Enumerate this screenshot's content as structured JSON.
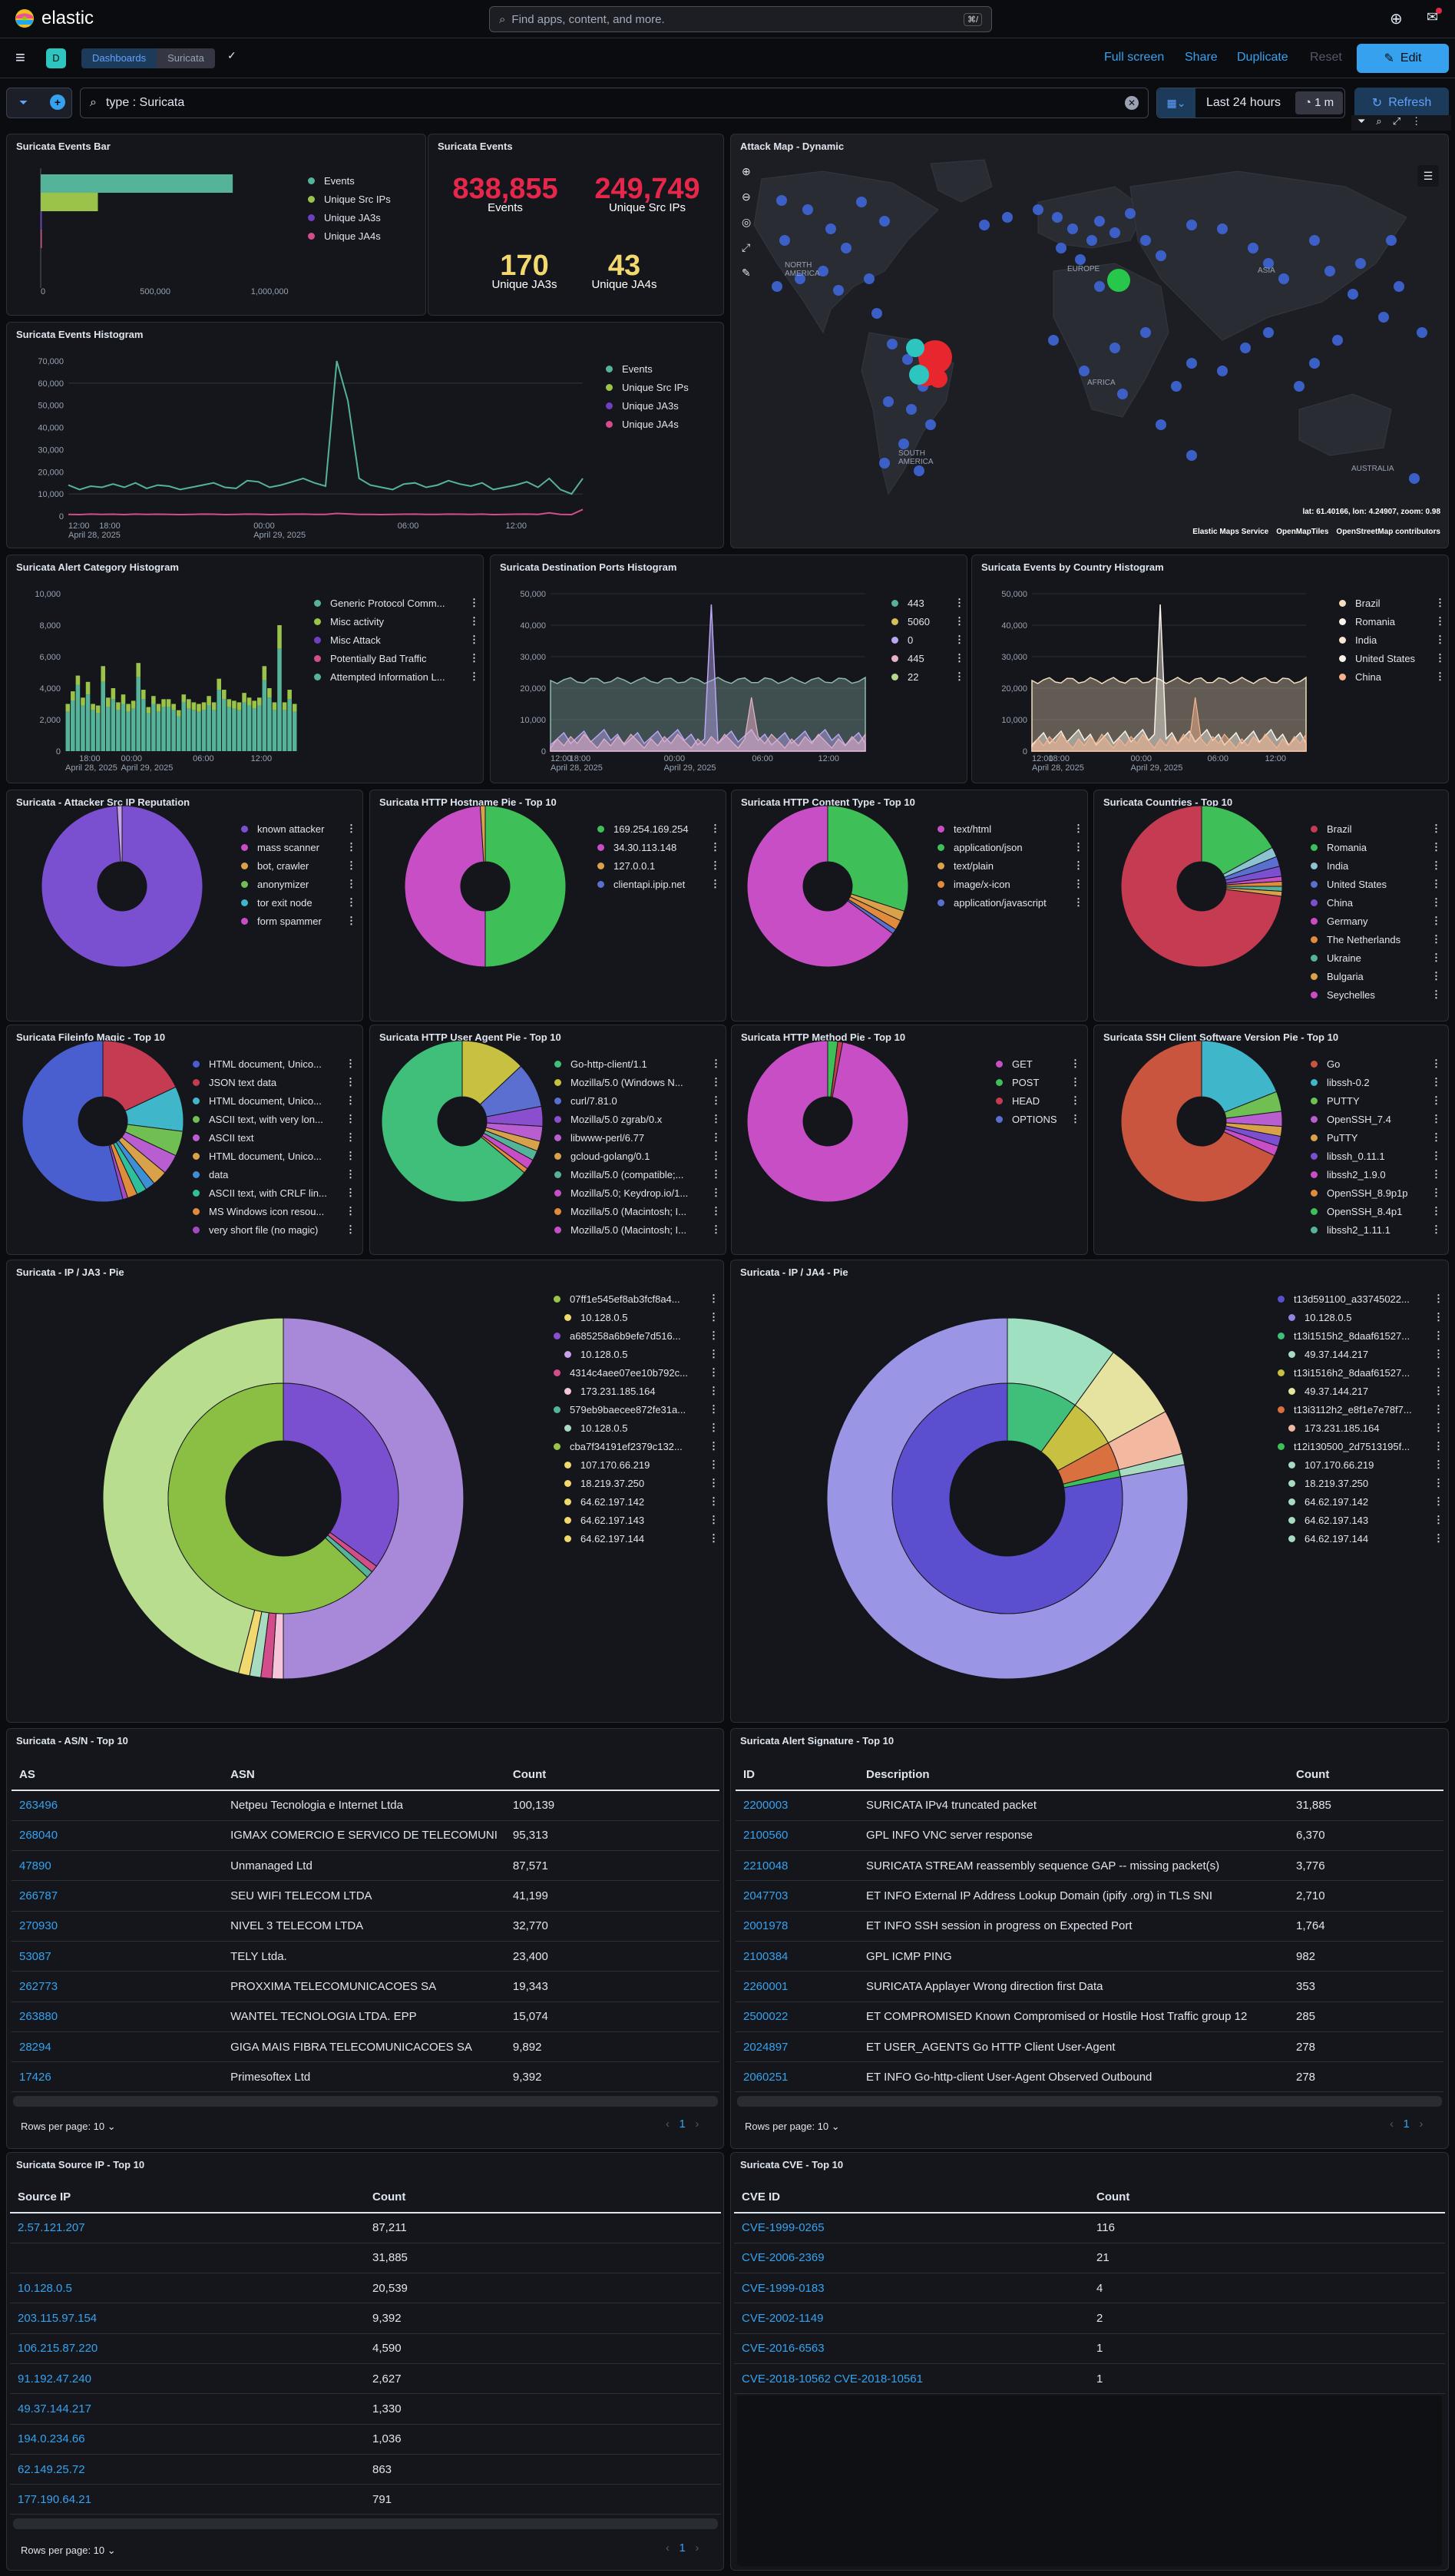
{
  "app": {
    "brand": "elastic",
    "search_placeholder": "Find apps, content, and more.",
    "search_kbd": "⌘/"
  },
  "nav": {
    "space": "D",
    "breadcrumbs": [
      "Dashboards",
      "Suricata"
    ],
    "fullscreen": "Full screen",
    "share": "Share",
    "duplicate": "Duplicate",
    "reset": "Reset",
    "edit": "Edit"
  },
  "query": {
    "text": "type : Suricata",
    "time": "Last 24 hours",
    "refresh_interval": "1 m",
    "refresh": "Refresh"
  },
  "colors": {
    "teal": "#54b399",
    "green": "#9bc34a",
    "purple": "#6f3fc1",
    "pink": "#d34d8a",
    "red": "#e7264b",
    "yellow": "#f1d86f"
  },
  "events_bar": {
    "title": "Suricata Events Bar",
    "legend": [
      "Events",
      "Unique Src IPs",
      "Unique JA3s",
      "Unique JA4s"
    ],
    "ticks": [
      "0",
      "500,000",
      "1,000,000"
    ],
    "chart_data": {
      "type": "bar",
      "categories": [
        "Events",
        "Unique Src IPs",
        "Unique JA3s",
        "Unique JA4s"
      ],
      "values": [
        838855,
        249749,
        170,
        43
      ],
      "xlim": [
        0,
        1100000
      ]
    }
  },
  "events": {
    "title": "Suricata Events",
    "metrics": [
      {
        "value": "838,855",
        "label": "Events"
      },
      {
        "value": "249,749",
        "label": "Unique Src IPs"
      },
      {
        "value": "170",
        "label": "Unique JA3s"
      },
      {
        "value": "43",
        "label": "Unique JA4s"
      }
    ]
  },
  "map": {
    "title": "Attack Map - Dynamic",
    "labels": [
      "NORTH AMERICA",
      "EUROPE",
      "ASIA",
      "AFRICA",
      "SOUTH AMERICA",
      "AUSTRALIA"
    ],
    "coords": "lat: 61.40166, lon: 4.24907, zoom: 0.98",
    "attribution": [
      "Elastic Maps Service",
      "OpenMapTiles",
      "OpenStreetMap contributors"
    ]
  },
  "histogram": {
    "title": "Suricata Events Histogram",
    "legend": [
      "Events",
      "Unique Src IPs",
      "Unique JA3s",
      "Unique JA4s"
    ],
    "yticks": [
      "70,000",
      "60,000",
      "50,000",
      "40,000",
      "30,000",
      "20,000",
      "10,000",
      "0"
    ],
    "xticks": [
      "12:00",
      "18:00",
      "00:00",
      "06:00",
      "12:00"
    ],
    "dates": [
      "April 28, 2025",
      "April 29, 2025"
    ],
    "chart_data": {
      "type": "line",
      "series": [
        {
          "name": "Events",
          "values": [
            14000,
            12000,
            13500,
            13000,
            14500,
            13000,
            15000,
            12500,
            14000,
            13500,
            12000,
            13000,
            14000,
            15000,
            13000,
            12500,
            16000,
            15500,
            13000,
            14000,
            15500,
            17000,
            15000,
            13500,
            70000,
            52000,
            17000,
            14000,
            13000,
            12000,
            14500,
            15000,
            13000,
            14000,
            16000,
            14500,
            13500,
            15000,
            12000,
            13000,
            14000,
            15500,
            13000,
            17000,
            12000,
            10000,
            17000
          ]
        },
        {
          "name": "Unique Src IPs",
          "values": [
            800,
            700,
            900,
            750,
            850,
            700,
            900,
            800,
            850,
            750,
            700,
            800,
            900,
            850,
            700,
            800,
            900,
            850,
            700,
            800,
            850,
            900,
            800,
            750,
            1200,
            1000,
            800,
            750,
            700,
            800,
            850,
            900,
            800,
            750,
            900,
            850,
            800,
            900,
            700,
            800,
            850,
            900,
            800,
            1500,
            800,
            700,
            3000
          ]
        }
      ],
      "ylim": [
        0,
        70000
      ]
    }
  },
  "alert_cat": {
    "title": "Suricata Alert Category Histogram",
    "legend": [
      "Generic Protocol Comm...",
      "Misc activity",
      "Misc Attack",
      "Potentially Bad Traffic",
      "Attempted Information L..."
    ],
    "yticks": [
      "10,000",
      "8,000",
      "6,000",
      "4,000",
      "2,000",
      "0"
    ],
    "xticks": [
      "18:00",
      "00:00",
      "06:00",
      "12:00"
    ],
    "dates": [
      "April 28, 2025",
      "April 29, 2025"
    ],
    "chart_data": {
      "type": "bar",
      "stacked": true,
      "series": [
        {
          "name": "Generic Protocol Comm...",
          "values": [
            2500,
            3200,
            4200,
            2900,
            3600,
            2600,
            2400,
            4400,
            2800,
            3300,
            2600,
            3000,
            2500,
            2700,
            4700,
            3300,
            2400,
            3000,
            2500,
            2800,
            2800,
            2600,
            2200,
            3100,
            2700,
            2600,
            2500,
            2600,
            2900,
            2600,
            3900,
            3300,
            2800,
            2700,
            2600,
            3100,
            2900,
            2700,
            2900,
            4500,
            3400,
            2600,
            6500,
            2600,
            3300,
            2500
          ]
        },
        {
          "name": "Misc activity",
          "values": [
            500,
            600,
            600,
            500,
            800,
            400,
            500,
            1000,
            600,
            700,
            500,
            600,
            500,
            500,
            900,
            600,
            400,
            500,
            500,
            500,
            500,
            400,
            400,
            500,
            600,
            500,
            500,
            500,
            600,
            500,
            700,
            600,
            500,
            500,
            500,
            600,
            500,
            500,
            500,
            900,
            600,
            500,
            1500,
            500,
            600,
            500
          ]
        }
      ],
      "ylim": [
        0,
        10000
      ]
    }
  },
  "dest_ports": {
    "title": "Suricata Destination Ports Histogram",
    "legend": [
      "443",
      "5060",
      "0",
      "445",
      "22"
    ],
    "yticks": [
      "50,000",
      "40,000",
      "30,000",
      "20,000",
      "10,000",
      "0"
    ],
    "xticks": [
      "12:00",
      "18:00",
      "00:00",
      "06:00",
      "12:00"
    ],
    "dates": [
      "April 28, 2025",
      "April 29, 2025"
    ]
  },
  "country_hist": {
    "title": "Suricata Events by Country Histogram",
    "legend": [
      "Brazil",
      "Romania",
      "India",
      "United States",
      "China"
    ],
    "yticks": [
      "50,000",
      "40,000",
      "30,000",
      "20,000",
      "10,000",
      "0"
    ],
    "xticks": [
      "12:00",
      "18:00",
      "00:00",
      "06:00",
      "12:00"
    ],
    "dates": [
      "April 28, 2025",
      "April 29, 2025"
    ]
  },
  "pie_rep": {
    "title": "Suricata - Attacker Src IP Reputation",
    "legend": [
      "known attacker",
      "mass scanner",
      "bot, crawler",
      "anonymizer",
      "tor exit node",
      "form spammer"
    ]
  },
  "pie_host": {
    "title": "Suricata HTTP Hostname Pie - Top 10",
    "legend": [
      "169.254.169.254",
      "34.30.113.148",
      "127.0.0.1",
      "clientapi.ipip.net"
    ]
  },
  "pie_ctype": {
    "title": "Suricata HTTP Content Type - Top 10",
    "legend": [
      "text/html",
      "application/json",
      "text/plain",
      "image/x-icon",
      "application/javascript"
    ]
  },
  "pie_country": {
    "title": "Suricata Countries - Top 10",
    "legend": [
      "Brazil",
      "Romania",
      "India",
      "United States",
      "China",
      "Germany",
      "The Netherlands",
      "Ukraine",
      "Bulgaria",
      "Seychelles"
    ]
  },
  "pie_magic": {
    "title": "Suricata Fileinfo Magic - Top 10",
    "legend": [
      "HTML document, Unico...",
      "JSON text data",
      "HTML document, Unico...",
      "ASCII text, with very lon...",
      "ASCII text",
      "HTML document, Unico...",
      "data",
      "ASCII text, with CRLF lin...",
      "MS Windows icon resou...",
      "very short file (no magic)"
    ]
  },
  "pie_ua": {
    "title": "Suricata HTTP User Agent Pie - Top 10",
    "legend": [
      "Go-http-client/1.1",
      "Mozilla/5.0 (Windows N...",
      "curl/7.81.0",
      "Mozilla/5.0 zgrab/0.x",
      "libwww-perl/6.77",
      "gcloud-golang/0.1",
      "Mozilla/5.0 (compatible;...",
      "Mozilla/5.0; Keydrop.io/1...",
      "Mozilla/5.0 (Macintosh; I...",
      "Mozilla/5.0 (Macintosh; I..."
    ]
  },
  "pie_method": {
    "title": "Suricata HTTP Method Pie - Top 10",
    "legend": [
      "GET",
      "POST",
      "HEAD",
      "OPTIONS"
    ]
  },
  "pie_ssh": {
    "title": "Suricata SSH Client Software Version Pie - Top 10",
    "legend": [
      "Go",
      "libssh-0.2",
      "PUTTY",
      "OpenSSH_7.4",
      "PuTTY",
      "libssh_0.11.1",
      "libssh2_1.9.0",
      "OpenSSH_8.9p1p",
      "OpenSSH_8.4p1",
      "libssh2_1.11.1"
    ]
  },
  "ja3": {
    "title": "Suricata - IP / JA3 - Pie",
    "legend": [
      "07ff1e545ef8ab3fcf8a4...",
      "10.128.0.5",
      "a685258a6b9efe7d516...",
      "10.128.0.5",
      "4314c4aee07ee10b792c...",
      "173.231.185.164",
      "579eb9baecee872fe31a...",
      "10.128.0.5",
      "cba7f34191ef2379c132...",
      "107.170.66.219",
      "18.219.37.250",
      "64.62.197.142",
      "64.62.197.143",
      "64.62.197.144"
    ]
  },
  "ja4": {
    "title": "Suricata - IP / JA4 - Pie",
    "legend": [
      "t13d591100_a33745022...",
      "10.128.0.5",
      "t13i1515h2_8daaf61527...",
      "49.37.144.217",
      "t13i1516h2_8daaf61527...",
      "49.37.144.217",
      "t13i3112h2_e8f1e7e78f7...",
      "173.231.185.164",
      "t12i130500_2d7513195f...",
      "107.170.66.219",
      "18.219.37.250",
      "64.62.197.142",
      "64.62.197.143",
      "64.62.197.144"
    ]
  },
  "asn": {
    "title": "Suricata - AS/N - Top 10",
    "cols": [
      "AS",
      "ASN",
      "Count"
    ],
    "rows": [
      [
        "263496",
        "Netpeu Tecnologia e Internet Ltda",
        "100,139"
      ],
      [
        "268040",
        "IGMAX COMERCIO E SERVICO DE TELECOMUNI",
        "95,313"
      ],
      [
        "47890",
        "Unmanaged Ltd",
        "87,571"
      ],
      [
        "266787",
        "SEU WIFI TELECOM LTDA",
        "41,199"
      ],
      [
        "270930",
        "NIVEL 3 TELECOM LTDA",
        "32,770"
      ],
      [
        "53087",
        "TELY Ltda.",
        "23,400"
      ],
      [
        "262773",
        "PROXXIMA TELECOMUNICACOES SA",
        "19,343"
      ],
      [
        "263880",
        "WANTEL TECNOLOGIA LTDA. EPP",
        "15,074"
      ],
      [
        "28294",
        "GIGA MAIS FIBRA TELECOMUNICACOES SA",
        "9,892"
      ],
      [
        "17426",
        "Primesoftex Ltd",
        "9,392"
      ]
    ],
    "rows_per_page": "Rows per page: 10",
    "page": "1"
  },
  "sig": {
    "title": "Suricata Alert Signature - Top 10",
    "cols": [
      "ID",
      "Description",
      "Count"
    ],
    "rows": [
      [
        "2200003",
        "SURICATA IPv4 truncated packet",
        "31,885"
      ],
      [
        "2100560",
        "GPL INFO VNC server response",
        "6,370"
      ],
      [
        "2210048",
        "SURICATA STREAM reassembly sequence GAP -- missing packet(s)",
        "3,776"
      ],
      [
        "2047703",
        "ET INFO External IP Address Lookup Domain (ipify .org) in TLS SNI",
        "2,710"
      ],
      [
        "2001978",
        "ET INFO SSH session in progress on Expected Port",
        "1,764"
      ],
      [
        "2100384",
        "GPL ICMP PING",
        "982"
      ],
      [
        "2260001",
        "SURICATA Applayer Wrong direction first Data",
        "353"
      ],
      [
        "2500022",
        "ET COMPROMISED Known Compromised or Hostile Host Traffic group 12",
        "285"
      ],
      [
        "2024897",
        "ET USER_AGENTS Go HTTP Client User-Agent",
        "278"
      ],
      [
        "2060251",
        "ET INFO Go-http-client User-Agent Observed Outbound",
        "278"
      ]
    ],
    "rows_per_page": "Rows per page: 10",
    "page": "1"
  },
  "srcip": {
    "title": "Suricata Source IP - Top 10",
    "cols": [
      "Source IP",
      "Count"
    ],
    "rows": [
      [
        "2.57.121.207",
        "87,211"
      ],
      [
        "",
        "31,885"
      ],
      [
        "10.128.0.5",
        "20,539"
      ],
      [
        "203.115.97.154",
        "9,392"
      ],
      [
        "106.215.87.220",
        "4,590"
      ],
      [
        "91.192.47.240",
        "2,627"
      ],
      [
        "49.37.144.217",
        "1,330"
      ],
      [
        "194.0.234.66",
        "1,036"
      ],
      [
        "62.149.25.72",
        "863"
      ],
      [
        "177.190.64.21",
        "791"
      ]
    ],
    "rows_per_page": "Rows per page: 10",
    "page": "1"
  },
  "cve": {
    "title": "Suricata CVE - Top 10",
    "cols": [
      "CVE ID",
      "Count"
    ],
    "rows": [
      [
        "CVE-1999-0265",
        "116"
      ],
      [
        "CVE-2006-2369",
        "21"
      ],
      [
        "CVE-1999-0183",
        "4"
      ],
      [
        "CVE-2002-1149",
        "2"
      ],
      [
        "CVE-2016-6563",
        "1"
      ],
      [
        "CVE-2018-10562 CVE-2018-10561",
        "1"
      ]
    ]
  }
}
